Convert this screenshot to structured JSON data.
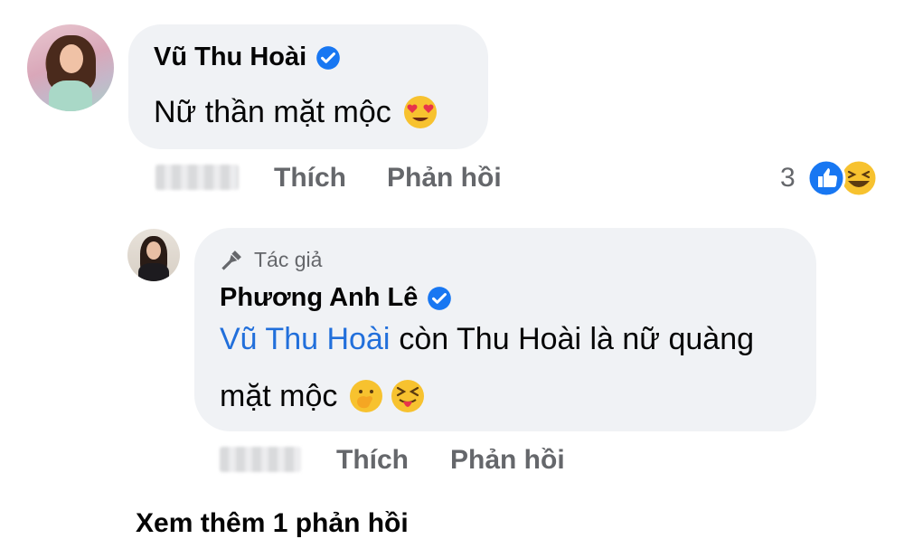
{
  "comment": {
    "author": "Vũ Thu Hoài",
    "text": "Nữ thần mặt mộc",
    "emoji": "heart-eyes-emoji",
    "actions": {
      "like": "Thích",
      "reply": "Phản hồi"
    },
    "reaction_count": "3",
    "reactions": [
      "like-reaction",
      "haha-reaction"
    ]
  },
  "reply": {
    "badge": "Tác giả",
    "author": "Phương Anh Lê",
    "mention": "Vũ Thu Hoài",
    "text_line1": "còn Thu Hoài là nữ quàng",
    "text_line2": "mặt mộc",
    "emojis": [
      "hand-over-mouth-emoji",
      "squinting-tongue-emoji"
    ],
    "actions": {
      "like": "Thích",
      "reply": "Phản hồi"
    }
  },
  "view_more": "Xem thêm 1 phản hồi",
  "colors": {
    "bubble": "#f0f2f5",
    "mention": "#216fdb",
    "verified": "#1877f2",
    "muted": "#65676b"
  }
}
